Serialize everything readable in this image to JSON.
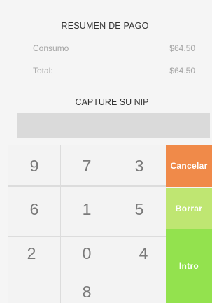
{
  "summary": {
    "title": "RESUMEN DE PAGO",
    "consumo_label": "Consumo",
    "consumo_value": "$64.50",
    "total_label": "Total:",
    "total_value": "$64.50"
  },
  "pin": {
    "title": "CAPTURE SU NIP",
    "value": ""
  },
  "keypad": {
    "k1": "9",
    "k2": "7",
    "k3": "3",
    "k4": "6",
    "k5": "1",
    "k6": "5",
    "k7": "2",
    "k8": "0",
    "k9": "4",
    "k10": "8"
  },
  "actions": {
    "cancel": "Cancelar",
    "erase": "Borrar",
    "enter": "Intro"
  },
  "colors": {
    "cancel": "#f08a49",
    "erase": "#bfe672",
    "enter": "#93e24e"
  }
}
